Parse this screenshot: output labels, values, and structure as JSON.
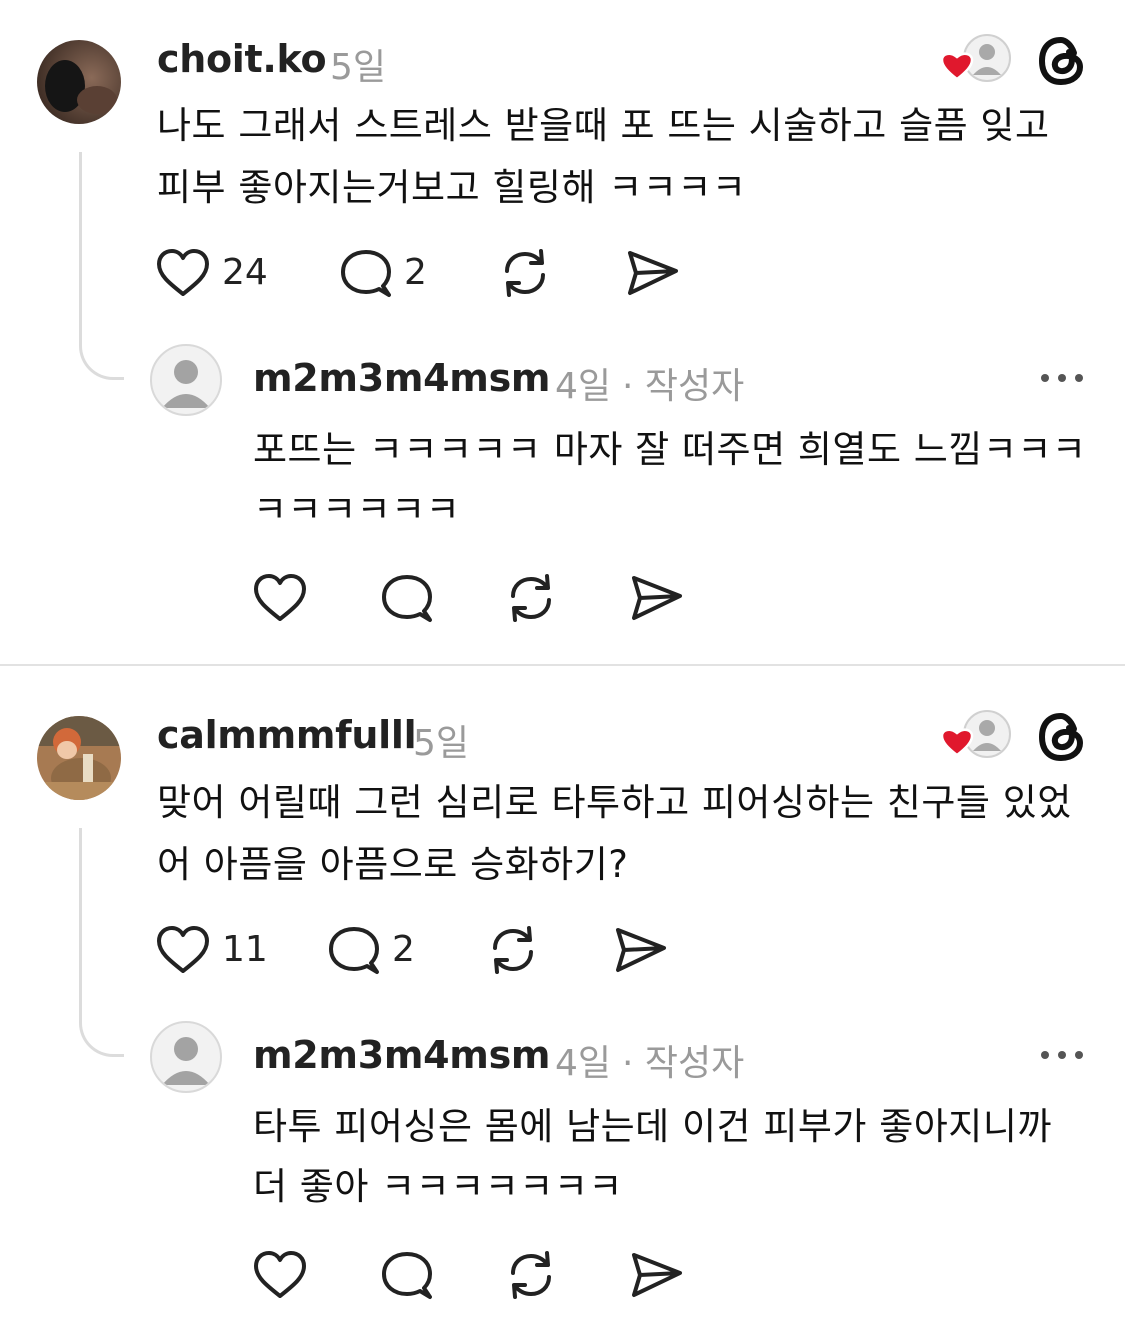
{
  "threads": [
    {
      "comment": {
        "username": "choit.ko",
        "time": "5일",
        "text": "나도 그래서 스트레스 받을때 포 뜨는 시술하고 슬픔 잊고 피부 좋아지는거보고 힐링해 ㅋㅋㅋㅋ",
        "likes": "24",
        "replies": "2"
      },
      "reply": {
        "username": "m2m3m4msm",
        "time": "4일",
        "author_tag": "· 작성자",
        "text": "포뜨는 ㅋㅋㅋㅋㅋ 마자 잘 떠주면 희열도 느낌ㅋㅋㅋㅋㅋㅋㅋㅋㅋ"
      }
    },
    {
      "comment": {
        "username": "calmmmfulll",
        "time": "5일",
        "text": "맞어 어릴때 그런 심리로 타투하고 피어싱하는 친구들 있었어 아픔을 아픔으로 승화하기?",
        "likes": "11",
        "replies": "2"
      },
      "reply": {
        "username": "m2m3m4msm",
        "time": "4일",
        "author_tag": "· 작성자",
        "text": "타투 피어싱은 몸에 남는데 이건 피부가 좋아지니까 더 좋아 ㅋㅋㅋㅋㅋㅋㅋ"
      }
    }
  ],
  "icons": {
    "like": "heart-icon",
    "comment": "comment-bubble-icon",
    "repost": "repost-icon",
    "share": "send-icon",
    "more": "more-dots-icon",
    "liked_by_author": "author-liked-icon",
    "threads_logo": "threads-logo-icon"
  },
  "colors": {
    "heart_red": "#e0182d",
    "muted_gray": "#9a9a9a",
    "text": "#111111"
  }
}
